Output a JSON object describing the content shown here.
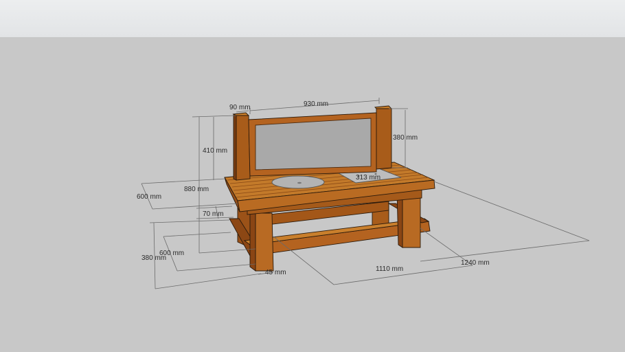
{
  "colors": {
    "sky": "#e4e6e8",
    "ground": "#c8c8c8",
    "wood_light": "#c97f2c",
    "wood_mid": "#b0601b",
    "wood_dark": "#7a3d12",
    "glass": "#a9a9a9",
    "steel": "#b9b9b9",
    "dimension_line": "#6a6a6a"
  },
  "dimensions": {
    "post_width": "90 mm",
    "backsplash_width": "930 mm",
    "post_height": "410 mm",
    "backsplash_height": "380 mm",
    "depth_top": "600 mm",
    "total_height": "880 mm",
    "apron": "70 mm",
    "depth_bottom": "600 mm",
    "leg_height": "380 mm",
    "leg_thickness": "45 mm",
    "inner_length": "1110 mm",
    "total_length": "1240 mm",
    "plate_size": "313 mm"
  }
}
